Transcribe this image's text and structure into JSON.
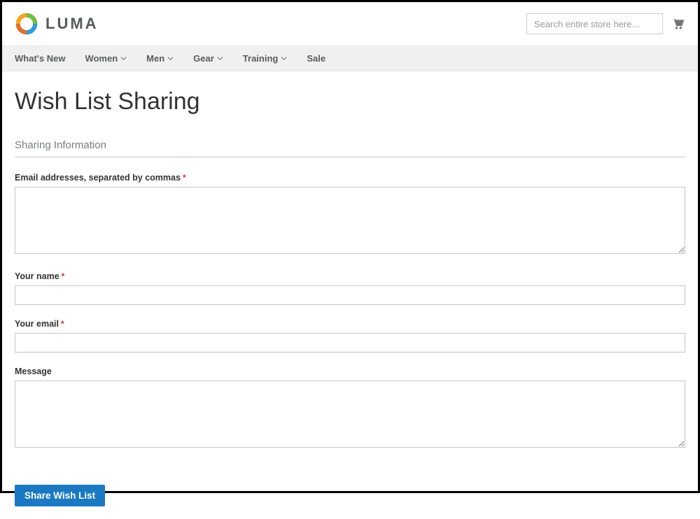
{
  "header": {
    "logo_text": "LUMA",
    "search_placeholder": "Search entire store here..."
  },
  "nav": {
    "items": [
      {
        "label": "What's New",
        "has_dropdown": false
      },
      {
        "label": "Women",
        "has_dropdown": true
      },
      {
        "label": "Men",
        "has_dropdown": true
      },
      {
        "label": "Gear",
        "has_dropdown": true
      },
      {
        "label": "Training",
        "has_dropdown": true
      },
      {
        "label": "Sale",
        "has_dropdown": false
      }
    ]
  },
  "page": {
    "title": "Wish List Sharing",
    "section_heading": "Sharing Information",
    "fields": {
      "emails_label": "Email addresses, separated by commas",
      "name_label": "Your name",
      "email_label": "Your email",
      "message_label": "Message"
    },
    "submit_label": "Share Wish List"
  }
}
